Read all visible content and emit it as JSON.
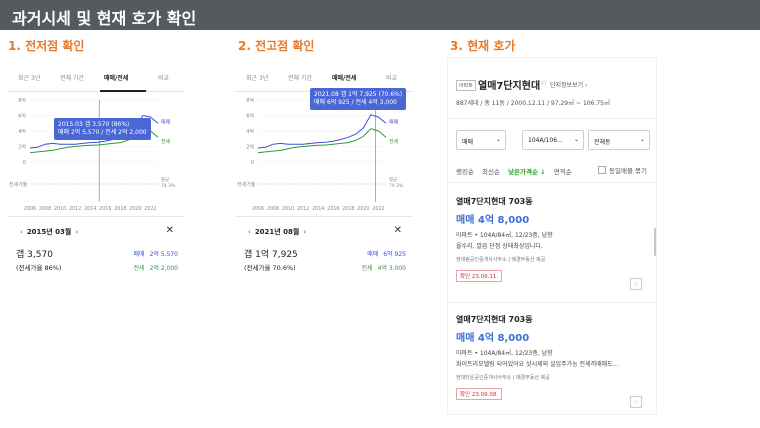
{
  "header": {
    "title": "과거시세 및 현재 호가 확인"
  },
  "sections": {
    "low": "1. 전저점 확인",
    "high": "2. 전고점 확인",
    "current": "3. 현재 호가"
  },
  "chart_tabs": [
    "최근 3년",
    "전체 기간",
    "매매/전세",
    "비교"
  ],
  "chart_common": {
    "y_ticks": [
      "8억",
      "6억",
      "4억",
      "2억",
      "0"
    ],
    "x_ticks": [
      "2006",
      "2008",
      "2010",
      "2012",
      "2014",
      "2016",
      "2018",
      "2020",
      "2022"
    ],
    "sale_label": "매매",
    "jeonse_label": "전세",
    "ratio_axis_label": "전세가율",
    "avg_label": "평균",
    "avg_value": "74.3%",
    "colors": {
      "sale": "#3d4fd6",
      "jeonse": "#2e9a3e",
      "tooltip": "#4a67d6",
      "accent": "#e8792b"
    }
  },
  "panels": {
    "low": {
      "tooltip_line1": "2015.03 갭 3,570 (86%)",
      "tooltip_line2": "매매 2억 5,570 / 전세 2억 2,000",
      "nav_date": "2015년 03월",
      "gap_prefix": "갭",
      "gap_value": "3,570",
      "ratio_text": "(전세가율 86%)",
      "sale_key": "매매",
      "sale_value": "2억 5,570",
      "jeonse_key": "전세",
      "jeonse_value": "2억 2,000"
    },
    "high": {
      "tooltip_line1": "2021.08 갭 1억 7,925 (70.6%)",
      "tooltip_line2": "매매 6억 925 / 전세 4억 3,000",
      "nav_date": "2021년 08월",
      "gap_prefix": "갭",
      "gap_value": "1억 7,925",
      "ratio_text": "(전세가율 70.6%)",
      "sale_key": "매매",
      "sale_value": "6억 925",
      "jeonse_key": "전세",
      "jeonse_value": "4억 3,000"
    }
  },
  "chart_data": [
    {
      "type": "line",
      "title": "",
      "x": [
        2006,
        2007,
        2008,
        2009,
        2010,
        2011,
        2012,
        2013,
        2014,
        2015,
        2016,
        2017,
        2018,
        2019,
        2020,
        2021,
        2022,
        2023
      ],
      "series": [
        {
          "name": "매매",
          "values": [
            1.8,
            1.9,
            2.3,
            2.4,
            2.3,
            2.3,
            2.3,
            2.4,
            2.5,
            2.56,
            2.7,
            2.9,
            3.2,
            3.6,
            4.4,
            6.0,
            5.8,
            5.0
          ]
        },
        {
          "name": "전세",
          "values": [
            1.2,
            1.3,
            1.4,
            1.5,
            1.7,
            1.9,
            2.0,
            2.1,
            2.15,
            2.2,
            2.3,
            2.4,
            2.5,
            2.8,
            3.3,
            4.3,
            4.0,
            3.2
          ]
        }
      ],
      "ylim": [
        0,
        8
      ],
      "highlight_x": 2015.2
    },
    {
      "type": "line",
      "title": "",
      "x": [
        2006,
        2007,
        2008,
        2009,
        2010,
        2011,
        2012,
        2013,
        2014,
        2015,
        2016,
        2017,
        2018,
        2019,
        2020,
        2021,
        2022,
        2023
      ],
      "series": [
        {
          "name": "매매",
          "values": [
            1.8,
            1.9,
            2.3,
            2.4,
            2.3,
            2.3,
            2.3,
            2.4,
            2.5,
            2.56,
            2.7,
            2.9,
            3.2,
            3.6,
            4.4,
            6.09,
            5.8,
            5.0
          ]
        },
        {
          "name": "전세",
          "values": [
            1.2,
            1.3,
            1.4,
            1.5,
            1.7,
            1.9,
            2.0,
            2.1,
            2.15,
            2.2,
            2.3,
            2.4,
            2.5,
            2.8,
            3.3,
            4.3,
            4.0,
            3.2
          ]
        }
      ],
      "ylim": [
        0,
        8
      ],
      "highlight_x": 2021.6
    }
  ],
  "listing": {
    "badge": "아파트",
    "name": "열매7단지현대",
    "info_link": "단지정보보기",
    "meta": "887세대 / 총 11동 / 2000.12.11 / 97.29㎡ ~ 106.75㎡",
    "filters": [
      "매매",
      "104A/106...",
      "전체동"
    ],
    "sorts": [
      "랭킹순",
      "최신순",
      "낮은가격순 ↓",
      "면적순"
    ],
    "same_listing_toggle": "동일매물 묶기",
    "items": [
      {
        "title": "열매7단지현대 703동",
        "price": "매매 4억 8,000",
        "spec": "아파트 • 104A/84㎡, 12/23층, 남향",
        "desc": "올수리, 깔끔 단정 상태최상입니다.",
        "agent": "현대림공인중개사사무소 | 매경부동산 제공",
        "date": "확인 23.09.11."
      },
      {
        "title": "열매7단지현대 703동",
        "price": "매매 4억 8,000",
        "spec": "아파트 • 104A/84㎡, 12/23층, 남향",
        "desc": "화이트리모델링 되어있어요 샷시제외 실입주가능 전세끼때매도...",
        "agent": "현대타운공인중개사사무소 | 매경부동산 제공",
        "date": "확인 23.09.08."
      }
    ]
  }
}
